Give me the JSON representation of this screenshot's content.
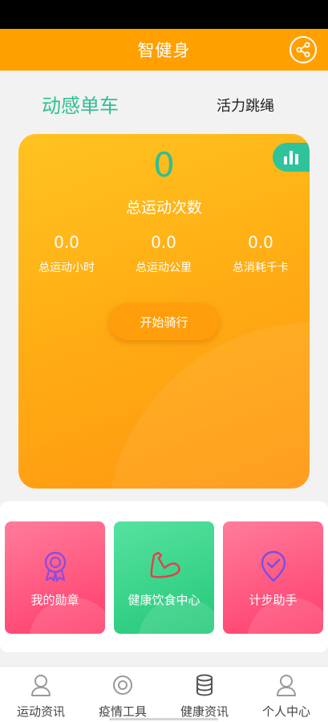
{
  "header": {
    "title": "智健身",
    "share_icon": "share-icon"
  },
  "tabs": [
    {
      "label": "动感单车",
      "active": true
    },
    {
      "label": "活力跳绳",
      "active": false
    }
  ],
  "summary": {
    "total_count": "0",
    "total_count_label": "总运动次数",
    "metrics": [
      {
        "value": "0.0",
        "label": "总运动小时"
      },
      {
        "value": "0.0",
        "label": "总运动公里"
      },
      {
        "value": "0.0",
        "label": "总消耗千卡"
      }
    ],
    "start_label": "开始骑行",
    "stats_icon": "bar-chart-icon"
  },
  "features": [
    {
      "label": "我的勋章",
      "icon": "medal-icon"
    },
    {
      "label": "健康饮食中心",
      "icon": "muscle-arm-icon"
    },
    {
      "label": "计步助手",
      "icon": "location-check-icon"
    }
  ],
  "bottom_nav": [
    {
      "label": "运动资讯",
      "icon": "person-icon"
    },
    {
      "label": "疫情工具",
      "icon": "target-icon"
    },
    {
      "label": "健康资讯",
      "icon": "database-icon"
    },
    {
      "label": "个人中心",
      "icon": "person-icon"
    }
  ],
  "colors": {
    "primary_orange": "#ffa000",
    "accent_teal": "#2fbf93",
    "pink": "#ff4d78",
    "green": "#2fd383"
  }
}
